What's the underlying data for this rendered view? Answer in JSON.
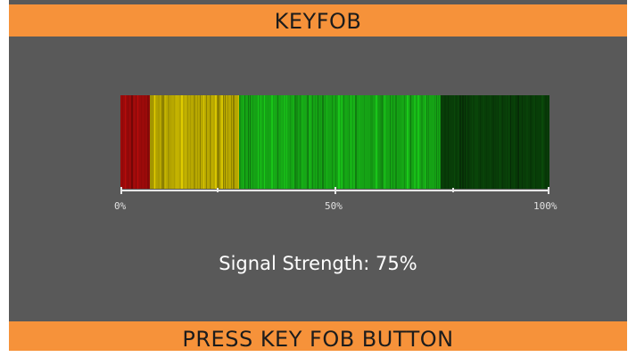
{
  "header": {
    "title": "KEYFOB"
  },
  "meter": {
    "signal_strength_percent": 75,
    "scale_labels": {
      "min": "0%",
      "mid": "50%",
      "max": "100%"
    },
    "colors": {
      "red": "#9b0a0a",
      "yellow": "#b8a800",
      "green": "#15a315",
      "dark_green": "#083d08",
      "background": "#595959",
      "accent": "#f6923a"
    }
  },
  "status": {
    "signal_text": "Signal Strength: 75%"
  },
  "footer": {
    "instruction": "PRESS KEY FOB BUTTON"
  }
}
